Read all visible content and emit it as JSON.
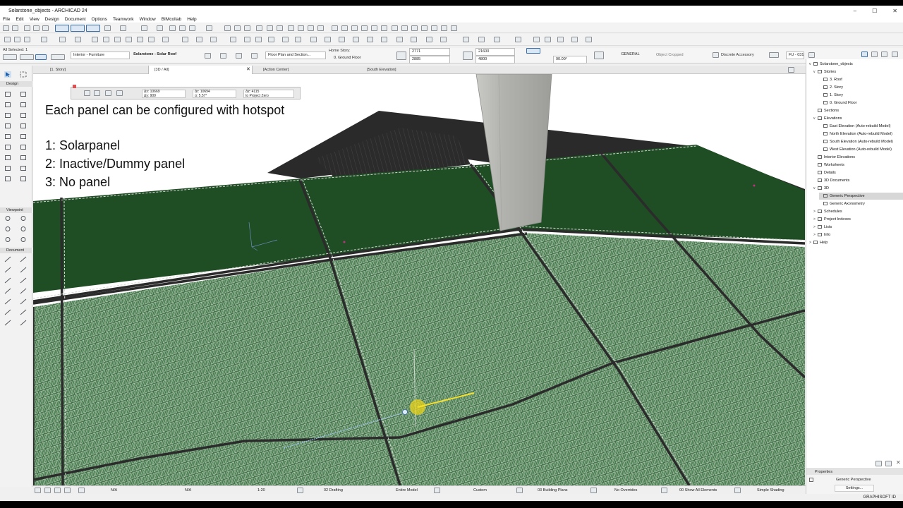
{
  "window": {
    "title": "Solarstone_objects - ARCHICAD 24",
    "controls": [
      "–",
      "☐",
      "✕"
    ]
  },
  "menu": [
    "File",
    "Edit",
    "View",
    "Design",
    "Document",
    "Options",
    "Teamwork",
    "Window",
    "BIMcollab",
    "Help"
  ],
  "infobox": {
    "all_selected": "All Selected: 1",
    "layer_preset": "Interior - Furniture",
    "object_name": "Solarstone - Solar Roof",
    "floor_plan": "Floor Plan and Section...",
    "home_story_label": "Home Story:",
    "home_story_value": "0. Ground Floor",
    "dim_a": "2771",
    "dim_b": "2885",
    "dim_c": "21600",
    "dim_d": "4800",
    "angle": "90.00°",
    "profile": "GENERAL",
    "object_cropped": "Object Cropped",
    "accessory": "Discrete Accessory",
    "id_value": "FU - 031"
  },
  "tabs": [
    {
      "label": "[1. Story]"
    },
    {
      "label": "[3D / All]",
      "active": true
    },
    {
      "label": "[Action Center]"
    },
    {
      "label": "[South Elevation]"
    }
  ],
  "toolbox": {
    "sections": [
      "Design",
      "Viewpoint",
      "Document"
    ],
    "selection_label": "Pointer"
  },
  "tracker": {
    "ax": "Δx: 10669",
    "ay": "Δy: 909",
    "ar": "Δr: 10694",
    "aa": "α: 5.57°",
    "az": "Δz: 4115",
    "ref": "to Project Zero"
  },
  "overlay": {
    "title": "Each panel can be configured with hotspot",
    "options": [
      "1: Solarpanel",
      "2: Inactive/Dummy panel",
      "3: No panel"
    ]
  },
  "navigator": {
    "root": "Solarstone_objects",
    "items": [
      {
        "label": "Stories",
        "level": 1,
        "caret": "v"
      },
      {
        "label": "3. Roof",
        "level": 2
      },
      {
        "label": "2. Story",
        "level": 2
      },
      {
        "label": "1. Story",
        "level": 2
      },
      {
        "label": "0. Ground Floor",
        "level": 2
      },
      {
        "label": "Sections",
        "level": 1
      },
      {
        "label": "Elevations",
        "level": 1,
        "caret": "v"
      },
      {
        "label": "East Elevation (Auto-rebuild Model)",
        "level": 2
      },
      {
        "label": "North Elevation (Auto-rebuild Model)",
        "level": 2
      },
      {
        "label": "South Elevation (Auto-rebuild Model)",
        "level": 2
      },
      {
        "label": "West Elevation (Auto-rebuild Model)",
        "level": 2
      },
      {
        "label": "Interior Elevations",
        "level": 1
      },
      {
        "label": "Worksheets",
        "level": 1
      },
      {
        "label": "Details",
        "level": 1
      },
      {
        "label": "3D Documents",
        "level": 1
      },
      {
        "label": "3D",
        "level": 1,
        "caret": "v"
      },
      {
        "label": "Generic Perspective",
        "level": 2,
        "selected": true
      },
      {
        "label": "Generic Axonometry",
        "level": 2
      },
      {
        "label": "Schedules",
        "level": 1,
        "caret": ">"
      },
      {
        "label": "Project Indexes",
        "level": 1,
        "caret": ">"
      },
      {
        "label": "Lists",
        "level": 1,
        "caret": ">"
      },
      {
        "label": "Info",
        "level": 1,
        "caret": ">"
      },
      {
        "label": "Help",
        "level": 0,
        "caret": ">"
      }
    ]
  },
  "properties": {
    "header": "Properties",
    "view_name": "Generic Perspective",
    "settings": "Settings..."
  },
  "statusbar": {
    "na1": "N/A",
    "na2": "N/A",
    "scale": "1:20",
    "layer_combo": "02 Drafting",
    "model": "Entire Model",
    "pen_set": "Custom",
    "mvo": "03 Building Plans",
    "overrides": "No Overrides",
    "renovation": "00 Show All Elements",
    "shading": "Simple Shading"
  },
  "brand": "GRAPHISOFT ID",
  "colors": {
    "panel_dark": "#1f4d24",
    "panel_grid": "#4a7a4e",
    "frame": "#9aa29a",
    "column": "#b9b9b5",
    "roof": "#2f2f2f",
    "hotspot": "#e8d31a"
  }
}
